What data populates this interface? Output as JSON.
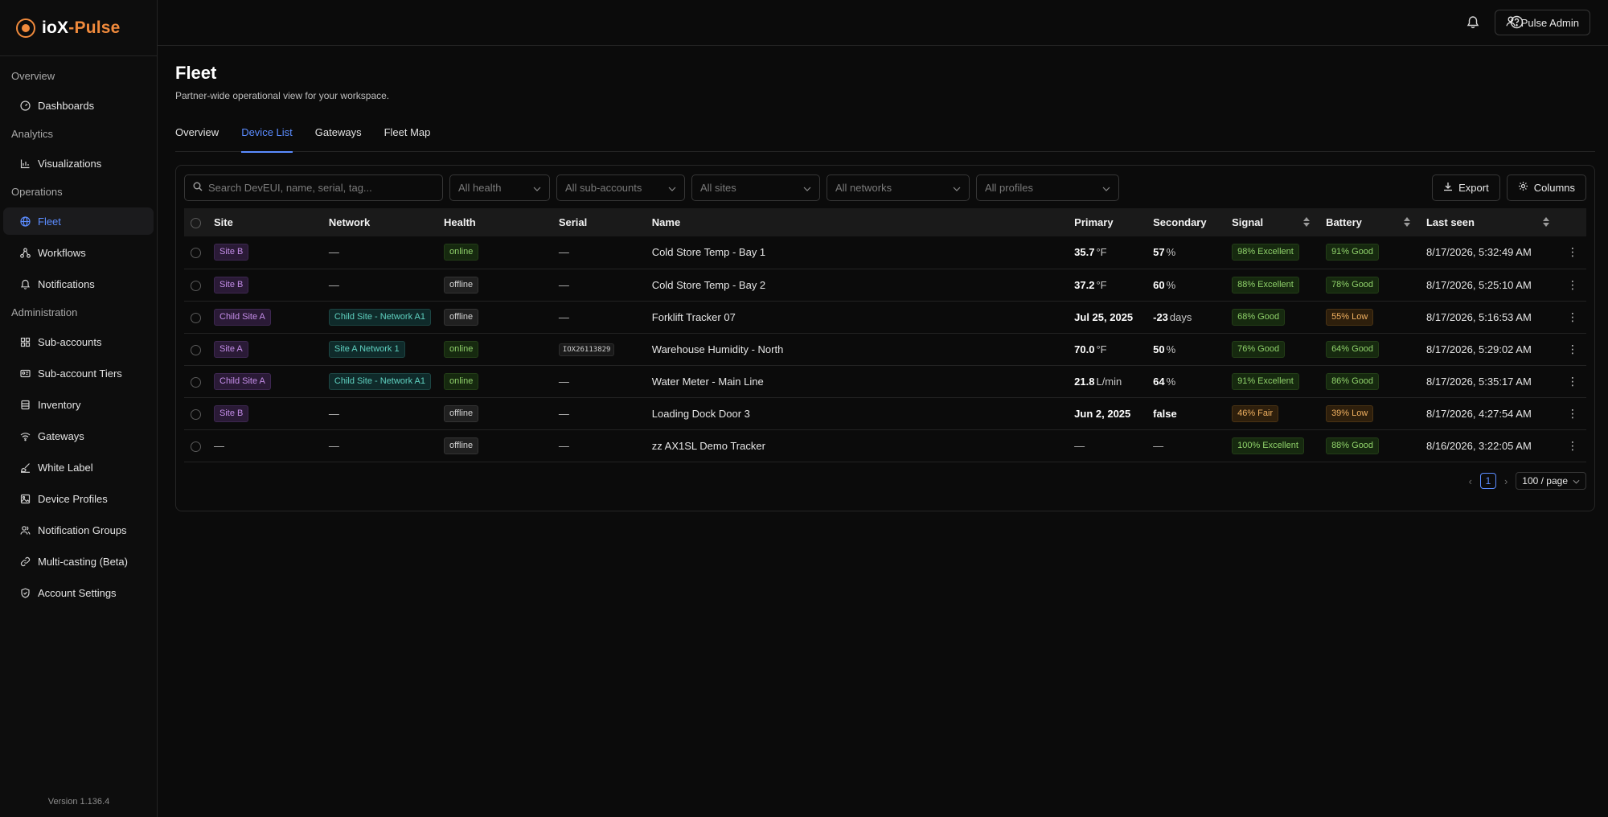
{
  "brand": {
    "name_part1": "ioX",
    "name_dash": "-",
    "name_part2": "Pulse"
  },
  "sidebar": {
    "sections": [
      {
        "label": "Overview",
        "items": [
          {
            "label": "Dashboards",
            "icon": "gauge-icon"
          }
        ]
      },
      {
        "label": "Analytics",
        "items": [
          {
            "label": "Visualizations",
            "icon": "chart-icon"
          }
        ]
      },
      {
        "label": "Operations",
        "items": [
          {
            "label": "Fleet",
            "icon": "globe-icon",
            "active": true
          },
          {
            "label": "Workflows",
            "icon": "workflow-icon"
          },
          {
            "label": "Notifications",
            "icon": "bell-icon"
          }
        ]
      },
      {
        "label": "Administration",
        "items": [
          {
            "label": "Sub-accounts",
            "icon": "grid-icon"
          },
          {
            "label": "Sub-account Tiers",
            "icon": "id-card-icon"
          },
          {
            "label": "Inventory",
            "icon": "database-icon"
          },
          {
            "label": "Gateways",
            "icon": "wifi-icon"
          },
          {
            "label": "White Label",
            "icon": "brush-icon"
          },
          {
            "label": "Device Profiles",
            "icon": "image-icon"
          },
          {
            "label": "Notification Groups",
            "icon": "users-icon"
          },
          {
            "label": "Multi-casting (Beta)",
            "icon": "link-icon"
          },
          {
            "label": "Account Settings",
            "icon": "shield-check-icon"
          }
        ]
      }
    ],
    "version": "Version 1.136.4"
  },
  "topbar": {
    "user_label": "Pulse Admin"
  },
  "page": {
    "title": "Fleet",
    "subtitle": "Partner-wide operational view for your workspace.",
    "tabs": [
      {
        "label": "Overview",
        "active": false
      },
      {
        "label": "Device List",
        "active": true
      },
      {
        "label": "Gateways",
        "active": false
      },
      {
        "label": "Fleet Map",
        "active": false
      }
    ]
  },
  "toolbar": {
    "search_placeholder": "Search DevEUI, name, serial, tag...",
    "filters": [
      "All health",
      "All sub-accounts",
      "All sites",
      "All networks",
      "All profiles"
    ],
    "export_label": "Export",
    "columns_label": "Columns"
  },
  "table": {
    "headers": {
      "site": "Site",
      "network": "Network",
      "health": "Health",
      "serial": "Serial",
      "name": "Name",
      "primary": "Primary",
      "secondary": "Secondary",
      "signal": "Signal",
      "battery": "Battery",
      "last_seen": "Last seen"
    },
    "rows": [
      {
        "site": "Site B",
        "network": "—",
        "health": "online",
        "serial": "—",
        "name": "Cold Store Temp - Bay 1",
        "primary_val": "35.7",
        "primary_unit": "°F",
        "secondary_val": "57",
        "secondary_unit": "%",
        "signal": "98% Excellent",
        "signal_level": "green",
        "battery": "91% Good",
        "battery_level": "green",
        "last_seen": "8/17/2026, 5:32:49 AM"
      },
      {
        "site": "Site B",
        "network": "—",
        "health": "offline",
        "serial": "—",
        "name": "Cold Store Temp - Bay 2",
        "primary_val": "37.2",
        "primary_unit": "°F",
        "secondary_val": "60",
        "secondary_unit": "%",
        "signal": "88% Excellent",
        "signal_level": "green",
        "battery": "78% Good",
        "battery_level": "green",
        "last_seen": "8/17/2026, 5:25:10 AM"
      },
      {
        "site": "Child Site A",
        "network": "Child Site - Network A1",
        "health": "offline",
        "serial": "—",
        "name": "Forklift Tracker 07",
        "primary_val": "Jul 25, 2025",
        "primary_unit": "",
        "secondary_val": "-23",
        "secondary_unit": "days",
        "signal": "68% Good",
        "signal_level": "green",
        "battery": "55% Low",
        "battery_level": "orange",
        "last_seen": "8/17/2026, 5:16:53 AM"
      },
      {
        "site": "Site A",
        "network": "Site A Network 1",
        "health": "online",
        "serial": "IOX26113829",
        "name": "Warehouse Humidity - North",
        "primary_val": "70.0",
        "primary_unit": "°F",
        "secondary_val": "50",
        "secondary_unit": "%",
        "signal": "76% Good",
        "signal_level": "green",
        "battery": "64% Good",
        "battery_level": "green",
        "last_seen": "8/17/2026, 5:29:02 AM"
      },
      {
        "site": "Child Site A",
        "network": "Child Site - Network A1",
        "health": "online",
        "serial": "—",
        "name": "Water Meter - Main Line",
        "primary_val": "21.8",
        "primary_unit": "L/min",
        "secondary_val": "64",
        "secondary_unit": "%",
        "signal": "91% Excellent",
        "signal_level": "green",
        "battery": "86% Good",
        "battery_level": "green",
        "last_seen": "8/17/2026, 5:35:17 AM"
      },
      {
        "site": "Site B",
        "network": "—",
        "health": "offline",
        "serial": "—",
        "name": "Loading Dock Door 3",
        "primary_val": "Jun 2, 2025",
        "primary_unit": "",
        "secondary_val": "false",
        "secondary_unit": "",
        "signal": "46% Fair",
        "signal_level": "orange",
        "battery": "39% Low",
        "battery_level": "orange",
        "last_seen": "8/17/2026, 4:27:54 AM"
      },
      {
        "site": "—",
        "network": "—",
        "health": "offline",
        "serial": "—",
        "name": "zz AX1SL Demo Tracker",
        "primary_val": "—",
        "primary_unit": "",
        "secondary_val": "—",
        "secondary_unit": "",
        "signal": "100% Excellent",
        "signal_level": "green",
        "battery": "88% Good",
        "battery_level": "green",
        "last_seen": "8/16/2026, 3:22:05 AM"
      }
    ]
  },
  "pagination": {
    "current_page": "1",
    "page_size": "100 / page"
  }
}
